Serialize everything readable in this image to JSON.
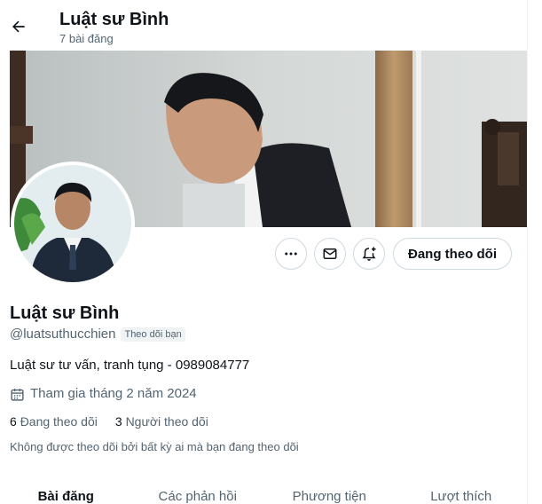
{
  "header": {
    "title": "Luật sư Bình",
    "post_count": "7 bài đăng"
  },
  "actions": {
    "follow_label": "Đang theo dõi"
  },
  "profile": {
    "display_name": "Luật sư Bình",
    "handle": "@luatsuthucchien",
    "follows_you_badge": "Theo dõi bạn",
    "bio": "Luật sư tư vấn, tranh tụng - 0989084777",
    "joined": "Tham gia tháng 2 năm 2024",
    "following_count": "6",
    "following_label": "Đang theo dõi",
    "followers_count": "3",
    "followers_label": "Người theo dõi",
    "mutual_note": "Không được theo dõi bởi bất kỳ ai mà bạn đang theo dõi"
  },
  "tabs": [
    {
      "label": "Bài đăng",
      "active": true
    },
    {
      "label": "Các phản hồi",
      "active": false
    },
    {
      "label": "Phương tiện",
      "active": false
    },
    {
      "label": "Lượt thích",
      "active": false
    }
  ],
  "icons": {
    "back": "arrow-left-icon",
    "more": "more-icon",
    "message": "envelope-icon",
    "notify": "bell-plus-icon",
    "calendar": "calendar-icon"
  }
}
